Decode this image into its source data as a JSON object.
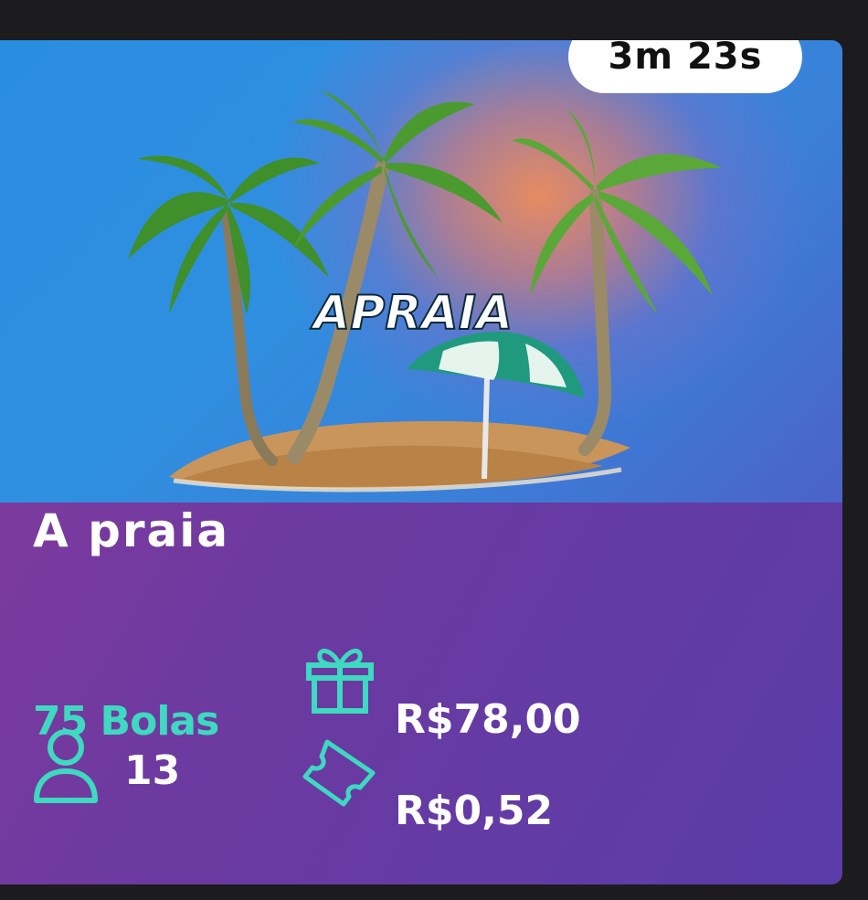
{
  "card": {
    "timer": "3m 23s",
    "image_logo": "APRAIA",
    "title": "A praia",
    "balls": "75 Bolas",
    "players": "13",
    "prize": "R$78,00",
    "price": "R$0,52"
  },
  "icons": {
    "players": "person-icon",
    "prize": "gift-icon",
    "price": "ticket-icon"
  },
  "colors": {
    "accent": "#3fd8c0",
    "card_bg": "#6c3aa0",
    "image_sky": "#2a8ee0"
  }
}
